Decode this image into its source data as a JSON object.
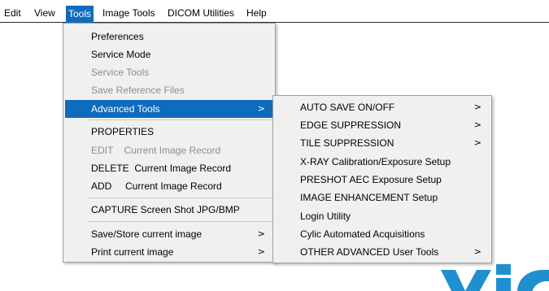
{
  "menubar": {
    "items": [
      {
        "label": "Edit"
      },
      {
        "label": "View"
      },
      {
        "label": "Tools"
      },
      {
        "label": "Image Tools"
      },
      {
        "label": "DICOM Utilities"
      },
      {
        "label": "Help"
      }
    ],
    "active_item": "Tools"
  },
  "tools_menu": {
    "items": [
      {
        "label": "Preferences",
        "enabled": true
      },
      {
        "label": "Service Mode",
        "enabled": true
      },
      {
        "label": "Service Tools",
        "enabled": false
      },
      {
        "label": "Save Reference Files",
        "enabled": false
      },
      {
        "label": "Advanced Tools",
        "enabled": true,
        "submenu": true,
        "highlighted": true
      },
      {
        "label": "PROPERTIES",
        "enabled": true
      },
      {
        "label": "EDIT    Current Image Record",
        "enabled": false
      },
      {
        "label": "DELETE  Current Image Record",
        "enabled": true
      },
      {
        "label": "ADD     Current Image Record",
        "enabled": true
      },
      {
        "label": "CAPTURE Screen Shot JPG/BMP",
        "enabled": true
      },
      {
        "label": "Save/Store current image",
        "enabled": true,
        "submenu": true
      },
      {
        "label": "Print current image",
        "enabled": true,
        "submenu": true
      }
    ]
  },
  "advanced_tools_menu": {
    "items": [
      {
        "label": "AUTO SAVE ON/OFF",
        "submenu": true
      },
      {
        "label": "EDGE SUPPRESSION",
        "submenu": true
      },
      {
        "label": "TILE SUPPRESSION",
        "submenu": true
      },
      {
        "label": "X-RAY Calibration/Exposure Setup",
        "submenu": false
      },
      {
        "label": "PRESHOT AEC Exposure Setup",
        "submenu": false
      },
      {
        "label": "IMAGE ENHANCEMENT Setup",
        "submenu": false
      },
      {
        "label": "Login Utility",
        "submenu": false
      },
      {
        "label": "Cylic Automated Acquisitions",
        "submenu": false
      },
      {
        "label": "OTHER ADVANCED User Tools",
        "submenu": true
      }
    ]
  },
  "submenu_arrow": ">",
  "colors": {
    "highlight": "#0f6bbd",
    "menu_bg": "#f0f0f0",
    "disabled_text": "#8d8d8d",
    "logo": "#1f8fd0"
  },
  "icons": {
    "submenu": "chevron-right-icon",
    "logo": "brand-logo-fragment"
  }
}
